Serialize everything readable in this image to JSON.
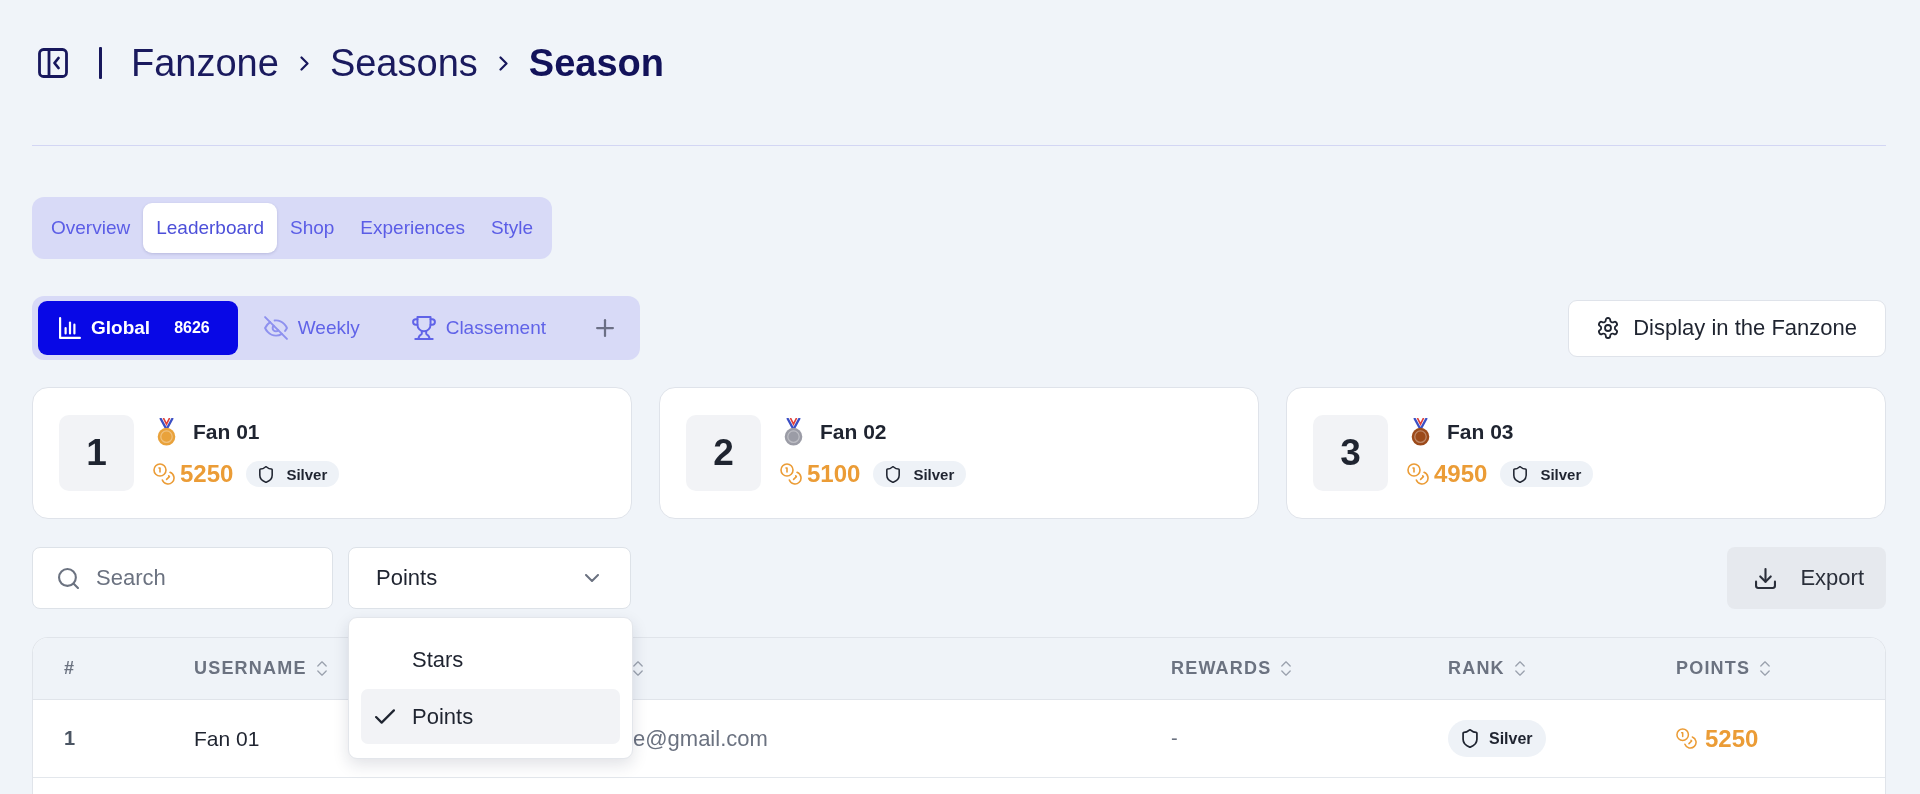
{
  "header": {
    "breadcrumb": [
      {
        "label": "Fanzone",
        "current": false
      },
      {
        "label": "Seasons",
        "current": false
      },
      {
        "label": "Season",
        "current": true
      }
    ]
  },
  "section_tabs": [
    {
      "label": "Overview",
      "selected": false
    },
    {
      "label": "Leaderboard",
      "selected": true
    },
    {
      "label": "Shop",
      "selected": false
    },
    {
      "label": "Experiences",
      "selected": false
    },
    {
      "label": "Style",
      "selected": false
    }
  ],
  "leaderboard_tabs": [
    {
      "label": "Global",
      "count": "8626",
      "selected": true
    },
    {
      "label": "Weekly",
      "selected": false
    },
    {
      "label": "Classement",
      "selected": false
    }
  ],
  "display_button": {
    "label": "Display in the Fanzone"
  },
  "podium": [
    {
      "rank": "1",
      "name": "Fan 01",
      "points": "5250",
      "tier": "Silver",
      "color": "#e9a23b"
    },
    {
      "rank": "2",
      "name": "Fan 02",
      "points": "5100",
      "tier": "Silver",
      "color": "#9b9ca6"
    },
    {
      "rank": "3",
      "name": "Fan 03",
      "points": "4950",
      "tier": "Silver",
      "color": "#9c4a1a"
    }
  ],
  "filters": {
    "search": {
      "placeholder": "Search"
    },
    "sort_select": {
      "value": "Points",
      "expanded": true,
      "options": [
        {
          "label": "Stars",
          "selected": false
        },
        {
          "label": "Points",
          "selected": true
        }
      ]
    }
  },
  "export_button": {
    "label": "Export"
  },
  "table": {
    "columns": [
      {
        "label": "#",
        "sortable": false
      },
      {
        "label": "USERNAME",
        "sortable": true
      },
      {
        "sortable": true
      },
      {
        "label": "REWARDS",
        "sortable": true
      },
      {
        "label": "RANK",
        "sortable": true
      },
      {
        "label": "POINTS",
        "sortable": true
      }
    ],
    "rows": [
      {
        "rank": "1",
        "username": "Fan 01",
        "email": "e@gmail.com",
        "rewards": "-",
        "tier": "Silver",
        "points": "5250"
      }
    ]
  }
}
